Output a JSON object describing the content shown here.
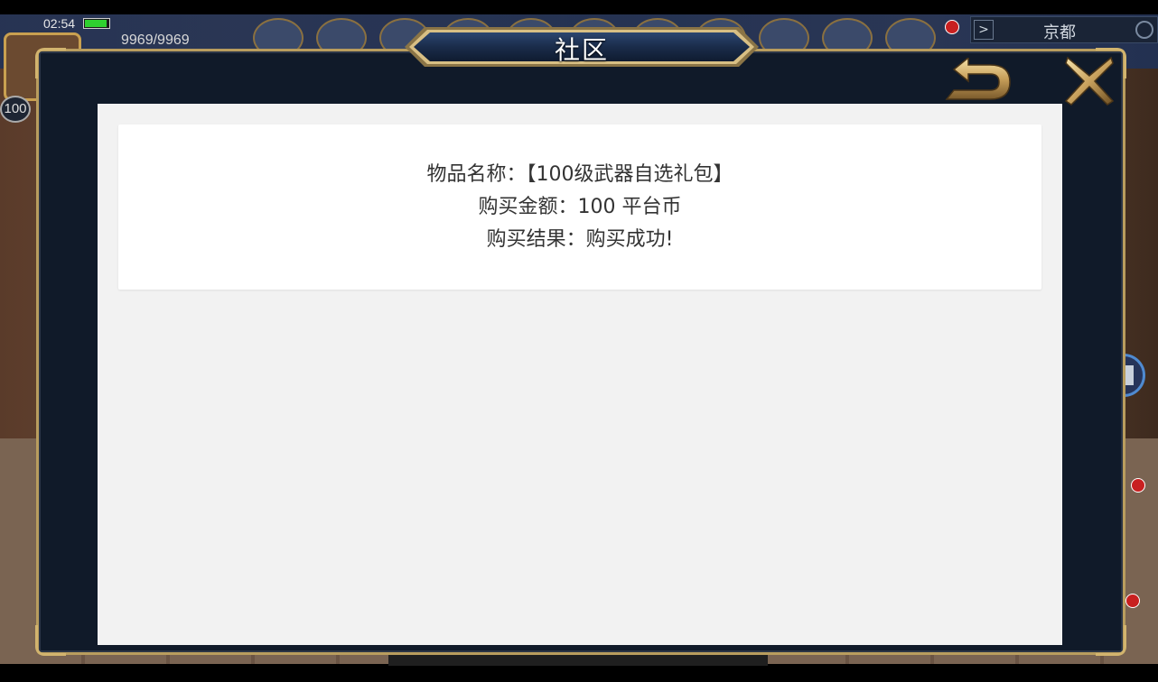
{
  "status_bar": {
    "time": "02:54"
  },
  "hud": {
    "stamina": "9969/9969",
    "level": "100",
    "location": "京都",
    "location_arrow": ">"
  },
  "dialog": {
    "title": "社区",
    "back_icon": "back-arrow-icon",
    "close_icon": "close-x-icon",
    "purchase_result": {
      "item_line": "物品名称：【100级武器自选礼包】",
      "amount_line": "购买金额：100 平台币",
      "result_line": "购买结果：购买成功!"
    }
  },
  "colors": {
    "frame_gold": "#b99d5e",
    "modal_bg": "#101a29",
    "content_bg": "#f2f2f2",
    "card_bg": "#ffffff",
    "text": "#333333"
  }
}
